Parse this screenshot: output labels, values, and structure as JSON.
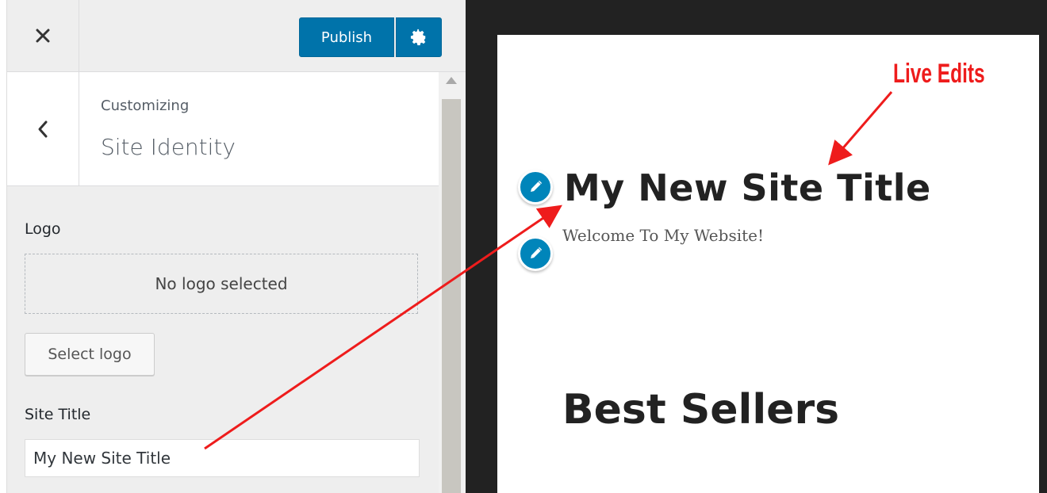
{
  "topbar": {
    "close_icon": "close-icon",
    "publish_label": "Publish",
    "settings_icon": "gear-icon",
    "button_color": "#0073aa"
  },
  "section_header": {
    "back_icon": "chevron-left-icon",
    "breadcrumb": "Customizing",
    "title": "Site Identity"
  },
  "logo": {
    "label": "Logo",
    "placeholder": "No logo selected",
    "select_label": "Select logo"
  },
  "site_title": {
    "label": "Site Title",
    "value": "My New Site Title"
  },
  "preview": {
    "site_title": "My New Site Title",
    "tagline": "Welcome To My Website!",
    "heading": "Best Sellers",
    "edit_icon": "pencil-icon",
    "edit_icon_color": "#0085ba"
  },
  "annotations": {
    "live_edits_label": "Live Edits",
    "arrow_color": "#ee1c1c"
  }
}
